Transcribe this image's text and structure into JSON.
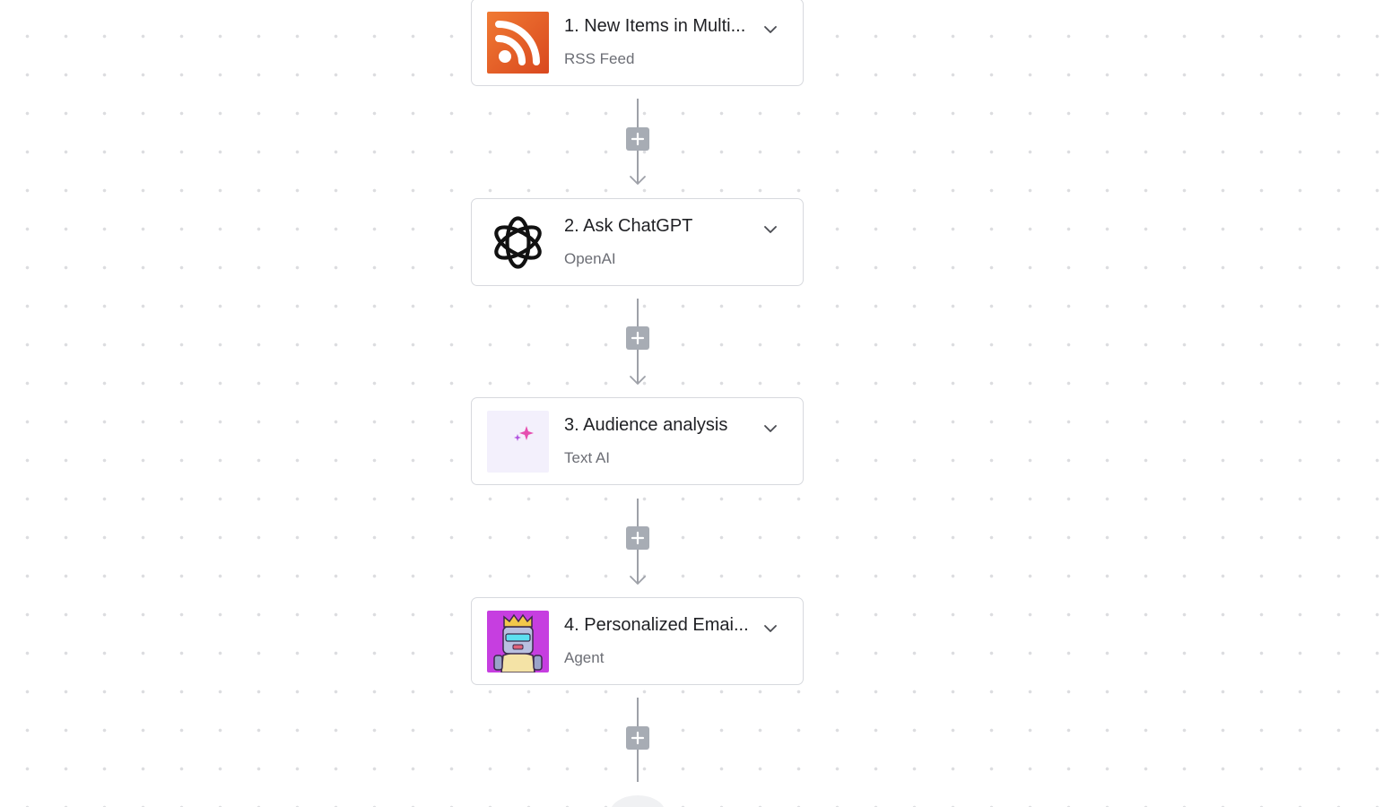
{
  "steps": [
    {
      "title": "1. New Items in Multi...",
      "app": "RSS Feed",
      "icon": "rss-feed-icon"
    },
    {
      "title": "2. Ask ChatGPT",
      "app": "OpenAI",
      "icon": "openai-icon"
    },
    {
      "title": "3. Audience analysis",
      "app": "Text AI",
      "icon": "text-ai-icon"
    },
    {
      "title": "4. Personalized Emai...",
      "app": "Agent",
      "icon": "agent-robot-icon"
    }
  ],
  "connector": {
    "add_glyph": "+",
    "icon": "plus-icon"
  },
  "colors": {
    "rss_orange": "#e8612c",
    "text_ai_bg": "#f3f0fc",
    "agent_bg": "#c63ee0",
    "connector_gray": "#9ea1a8",
    "add_button_gray": "#a7acb4"
  }
}
